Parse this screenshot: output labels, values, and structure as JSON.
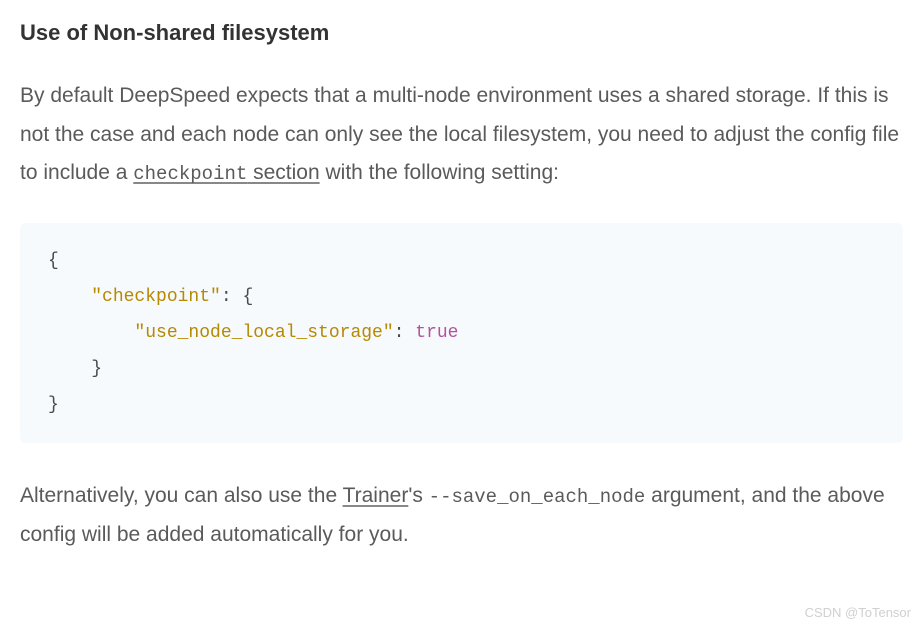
{
  "heading": "Use of Non-shared filesystem",
  "paragraph1": {
    "text_before_link": "By default DeepSpeed expects that a multi-node environment uses a shared storage. If this is not the case and each node can only see the local filesystem, you need to adjust the config file to include a ",
    "link_code": "checkpoint",
    "link_text": " section",
    "text_after_link": " with the following setting:"
  },
  "code": {
    "line1": "{",
    "line2_indent": "    ",
    "line2_key": "\"checkpoint\"",
    "line2_after": ": {",
    "line3_indent": "        ",
    "line3_key": "\"use_node_local_storage\"",
    "line3_after": ": ",
    "line3_bool": "true",
    "line4": "    }",
    "line5": "}"
  },
  "paragraph2": {
    "text_before_link": "Alternatively, you can also use the ",
    "link_text": "Trainer",
    "text_after_link1": "'s ",
    "code_text": "--save_on_each_node",
    "text_after_code": " argument, and the above config will be added automatically for you."
  },
  "watermark": "CSDN @ToTensor"
}
